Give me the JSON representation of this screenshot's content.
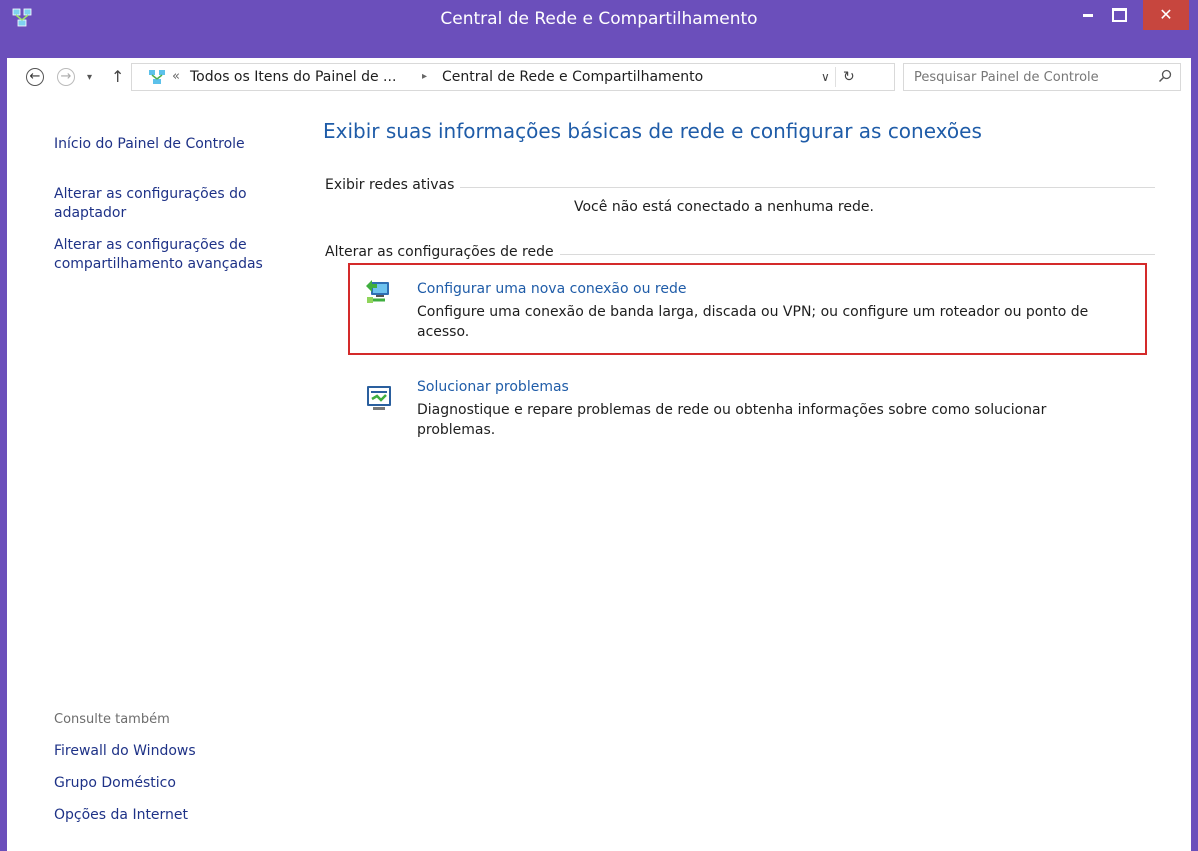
{
  "window": {
    "title": "Central de Rede e Compartilhamento",
    "minimize_icon": "minimize-icon",
    "maximize_icon": "maximize-icon",
    "close_symbol": "✕",
    "accent_color": "#6b4fbb",
    "close_color": "#c7463e"
  },
  "address_bar": {
    "overflow_marker": "«",
    "breadcrumbs": [
      "Todos os Itens do Painel de ...",
      "Central de Rede e Compartilhamento"
    ],
    "separator": "▸",
    "dropdown_symbol": "∨",
    "refresh_symbol": "↻",
    "search_placeholder": "Pesquisar Painel de Controle",
    "back_symbol": "←",
    "forward_symbol": "→",
    "up_symbol": "↑",
    "recent_symbol": "▾"
  },
  "sidebar": {
    "home_link": "Início do Painel de Controle",
    "adapter_link": "Alterar as configurações do adaptador",
    "sharing_link": "Alterar as configurações de compartilhamento avançadas",
    "see_also_heading": "Consulte também",
    "see_also": [
      "Firewall do Windows",
      "Grupo Doméstico",
      "Opções da Internet"
    ]
  },
  "main": {
    "title": "Exibir suas informações básicas de rede e configurar as conexões",
    "active_networks_heading": "Exibir redes ativas",
    "no_network_text": "Você não está conectado a nenhuma rede.",
    "change_settings_heading": "Alterar as configurações de rede",
    "tasks": [
      {
        "link": "Configurar uma nova conexão ou rede",
        "description": "Configure uma conexão de banda larga, discada ou VPN; ou configure um roteador ou ponto de acesso.",
        "icon": "network-setup-icon",
        "highlighted": true
      },
      {
        "link": "Solucionar problemas",
        "description": "Diagnostique e repare problemas de rede ou obtenha informações sobre como solucionar problemas.",
        "icon": "troubleshoot-icon",
        "highlighted": false
      }
    ],
    "highlight_color": "#d42a2a",
    "link_color": "#1f5ca8"
  }
}
